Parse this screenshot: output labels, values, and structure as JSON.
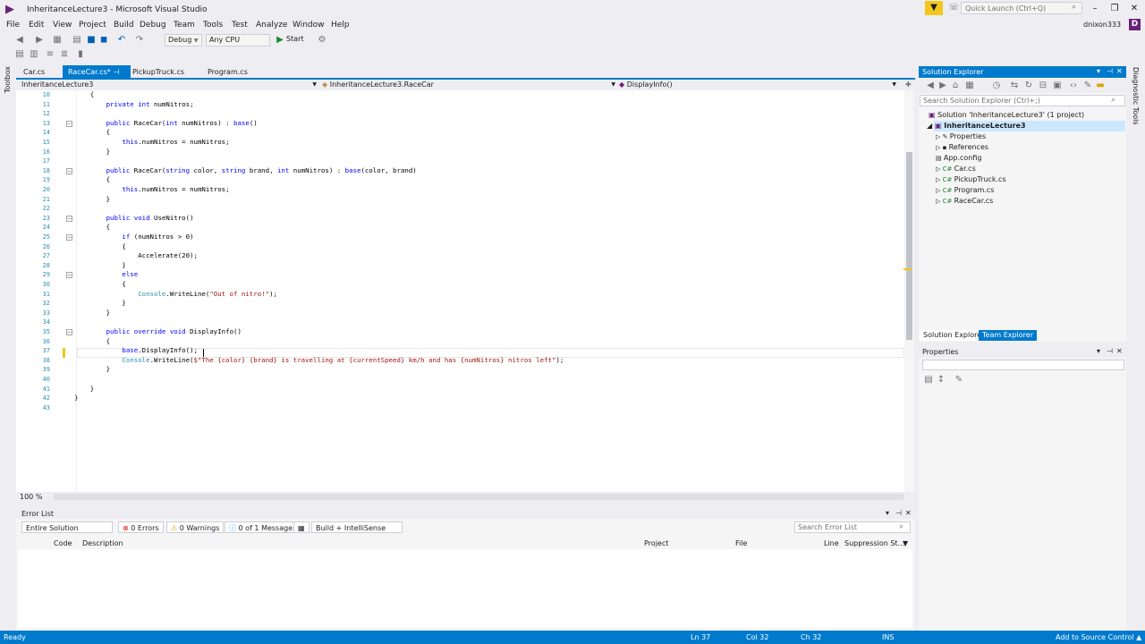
{
  "window": {
    "title": "InheritanceLecture3 - Microsoft Visual Studio",
    "quick_launch_placeholder": "Quick Launch (Ctrl+Q)",
    "user": "dnixon333",
    "user_initial": "D"
  },
  "menu": [
    "File",
    "Edit",
    "View",
    "Project",
    "Build",
    "Debug",
    "Team",
    "Tools",
    "Test",
    "Analyze",
    "Window",
    "Help"
  ],
  "toolbar": {
    "config": "Debug",
    "platform": "Any CPU",
    "start_label": "Start"
  },
  "side_tabs": {
    "left": "Toolbox",
    "right": "Diagnostic Tools"
  },
  "doc_tabs": [
    {
      "label": "Car.cs",
      "active": false
    },
    {
      "label": "RaceCar.cs*",
      "active": true
    },
    {
      "label": "PickupTruck.cs",
      "active": false
    },
    {
      "label": "Program.cs",
      "active": false
    }
  ],
  "nav_bar": {
    "project": "InheritanceLecture3",
    "class": "InheritanceLecture3.RaceCar",
    "member": "DisplayInfo()"
  },
  "editor": {
    "zoom": "100 %",
    "lines": [
      {
        "n": "10",
        "text": "    {"
      },
      {
        "n": "11",
        "text": "        private int numNitros;"
      },
      {
        "n": "12",
        "text": ""
      },
      {
        "n": "13",
        "text": "        public RaceCar(int numNitros) : base()"
      },
      {
        "n": "14",
        "text": "        {"
      },
      {
        "n": "15",
        "text": "            this.numNitros = numNitros;"
      },
      {
        "n": "16",
        "text": "        }"
      },
      {
        "n": "17",
        "text": ""
      },
      {
        "n": "18",
        "text": "        public RaceCar(string color, string brand, int numNitros) : base(color, brand)"
      },
      {
        "n": "19",
        "text": "        {"
      },
      {
        "n": "20",
        "text": "            this.numNitros = numNitros;"
      },
      {
        "n": "21",
        "text": "        }"
      },
      {
        "n": "22",
        "text": ""
      },
      {
        "n": "23",
        "text": "        public void UseNitro()"
      },
      {
        "n": "24",
        "text": "        {"
      },
      {
        "n": "25",
        "text": "            if (numNitros > 0)"
      },
      {
        "n": "26",
        "text": "            {"
      },
      {
        "n": "27",
        "text": "                Accelerate(20);"
      },
      {
        "n": "28",
        "text": "            }"
      },
      {
        "n": "29",
        "text": "            else"
      },
      {
        "n": "30",
        "text": "            {"
      },
      {
        "n": "31",
        "text": "                Console.WriteLine(\"Out of nitro!\");"
      },
      {
        "n": "32",
        "text": "            }"
      },
      {
        "n": "33",
        "text": "        }"
      },
      {
        "n": "34",
        "text": ""
      },
      {
        "n": "35",
        "text": "        public override void DisplayInfo()"
      },
      {
        "n": "36",
        "text": "        {"
      },
      {
        "n": "37",
        "text": "            base.DisplayInfo();"
      },
      {
        "n": "38",
        "text": "            Console.WriteLine($\"The {color} {brand} is travelling at {currentSpeed} km/h and has {numNitros} nitros left\");"
      },
      {
        "n": "39",
        "text": "        }"
      },
      {
        "n": "40",
        "text": ""
      },
      {
        "n": "41",
        "text": "    }"
      },
      {
        "n": "42",
        "text": "}"
      },
      {
        "n": "43",
        "text": ""
      }
    ]
  },
  "solution_explorer": {
    "title": "Solution Explorer",
    "search_placeholder": "Search Solution Explorer (Ctrl+;)",
    "solution": "Solution 'InheritanceLecture3' (1 project)",
    "project": "InheritanceLecture3",
    "items": [
      "Properties",
      "References",
      "App.config",
      "Car.cs",
      "PickupTruck.cs",
      "Program.cs",
      "RaceCar.cs"
    ],
    "tabs": [
      "Solution Explorer",
      "Team Explorer"
    ]
  },
  "properties": {
    "title": "Properties"
  },
  "error_list": {
    "title": "Error List",
    "scope": "Entire Solution",
    "errors": "0 Errors",
    "warnings": "0 Warnings",
    "messages": "0 of 1 Message",
    "source": "Build + IntelliSense",
    "search_placeholder": "Search Error List",
    "columns": [
      "Code",
      "Description",
      "Project",
      "File",
      "Line",
      "Suppression St..."
    ]
  },
  "status_bar": {
    "state": "Ready",
    "ln": "Ln 37",
    "col": "Col 32",
    "ch": "Ch 32",
    "mode": "INS",
    "source_control": "Add to Source Control"
  },
  "colors": {
    "accent": "#007acc",
    "brand": "#68217a",
    "keyword": "#0000ff",
    "string": "#a31515",
    "type": "#2b91af"
  }
}
